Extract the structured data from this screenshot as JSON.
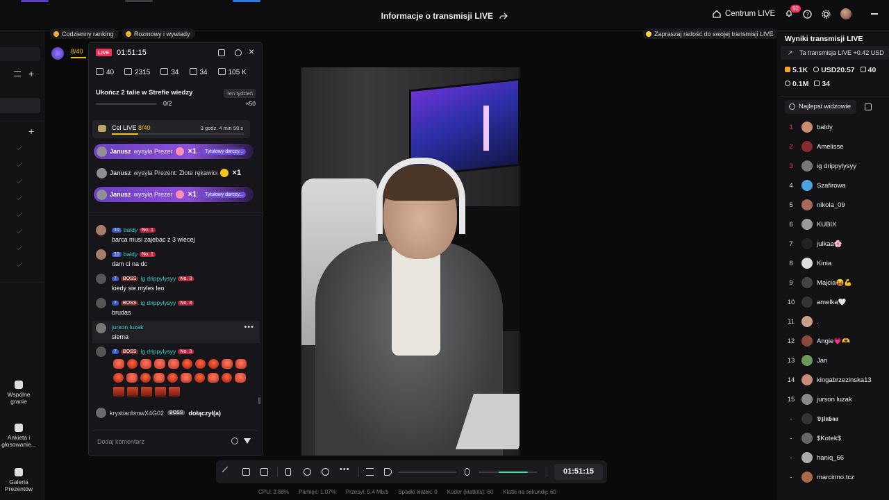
{
  "header": {
    "title": "Informacje o transmisji LIVE",
    "centrum_label": "Centrum LIVE",
    "notif_count": "92"
  },
  "pills": {
    "ranking": "Codzienny ranking",
    "rozmowy": "Rozmowy i wywiady",
    "invite": "Zapraszaj radość do swojej transmisji LIVE"
  },
  "level_indicator": "8/40",
  "chat": {
    "live_badge": "LIVE",
    "timer": "01:51:15",
    "stats": [
      "40",
      "2315",
      "34",
      "34",
      "105 K"
    ],
    "quest": {
      "title": "Ukończ 2 talie w Strefie wiedzy",
      "badge": "Ten tydzień",
      "progress": "0/2",
      "reward": "×50"
    },
    "goal": {
      "label": "Cel LIVE",
      "value": "8/40",
      "progress_fraction": 0.2,
      "time": "3 godz. 4 min 58 s"
    },
    "gifts": [
      {
        "name": "Janusz",
        "text": "wysyła Prezer",
        "count": "×1",
        "tag": "Tytułowy darczy...",
        "highlight": true
      },
      {
        "name": "Janusz",
        "text": "wysyła Prezent: Złote rękawice",
        "count": "×1",
        "tag": "",
        "highlight": false
      },
      {
        "name": "Janusz",
        "text": "wysyła Prezer",
        "count": "×1",
        "tag": "Tytułowy darczy...",
        "highlight": true
      }
    ],
    "messages": [
      {
        "level": "10",
        "boss": "",
        "name": "baldy",
        "no": "No. 1",
        "text": "barca musi zajebac z 3 wiecej"
      },
      {
        "level": "10",
        "boss": "",
        "name": "baldy",
        "no": "No. 1",
        "text": "dam ci na dc"
      },
      {
        "level": "7",
        "boss": "BOSS",
        "name": "ig drippylysyy",
        "no": "No. 3",
        "text": "kiedy sie myles leo"
      },
      {
        "level": "7",
        "boss": "BOSS",
        "name": "ig drippylysyy",
        "no": "No. 3",
        "text": "brudas"
      },
      {
        "level": "",
        "boss": "",
        "name": "jurson luzak",
        "no": "",
        "text": "siema"
      },
      {
        "level": "7",
        "boss": "BOSS",
        "name": "ig drippylysyy",
        "no": "No. 3",
        "text": ""
      }
    ],
    "joined": {
      "name": "krystianbmwX4G02",
      "boss": "BOSS",
      "text": "dołączył(a)"
    },
    "comment_placeholder": "Dodaj komentarz"
  },
  "toolbar": {
    "clock": "01:51:15",
    "volume_fraction": 0.0,
    "mic_fraction": 0.5
  },
  "footer": [
    "CPU: 2.88%",
    "Pamięć: 1.07%",
    "Przesył: 5.4 Mb/s",
    "Spadki klatek: 0",
    "Koder (klatki/s): 60",
    "Klatki na sekundę: 60"
  ],
  "sidebar_tools": [
    "Wspólne granie",
    "Ankieta i głosowanie...",
    "Galeria Prezentów"
  ],
  "right": {
    "title": "Wyniki transmisji LIVE",
    "boost": "Ta transmisja LIVE +0.42 USD",
    "stats1": [
      "5.1K",
      "USD20.57",
      "40"
    ],
    "stats2": [
      "0.1M",
      "34"
    ],
    "top_viewers_label": "Najlepsi widzowie",
    "viewers": [
      {
        "rank": "1",
        "name": "baldy"
      },
      {
        "rank": "2",
        "name": "Amelisse"
      },
      {
        "rank": "3",
        "name": "ig drippylysyy"
      },
      {
        "rank": "4",
        "name": "Szafirowa"
      },
      {
        "rank": "5",
        "name": "nikola_09"
      },
      {
        "rank": "6",
        "name": "KUBIX"
      },
      {
        "rank": "7",
        "name": "julkaa🌸"
      },
      {
        "rank": "8",
        "name": "Kinia"
      },
      {
        "rank": "9",
        "name": "Majcia😝💪"
      },
      {
        "rank": "10",
        "name": "amelka🤍"
      },
      {
        "rank": "11",
        "name": "."
      },
      {
        "rank": "12",
        "name": "Angie💗🫶"
      },
      {
        "rank": "13",
        "name": "Jan"
      },
      {
        "rank": "14",
        "name": "kingabrzezinska13"
      },
      {
        "rank": "15",
        "name": "jurson luzak"
      },
      {
        "rank": "-",
        "name": "𝕯𝖟𝖎𝖚𝖇𝖆𝖆"
      },
      {
        "rank": "-",
        "name": "$Kotek$"
      },
      {
        "rank": "-",
        "name": "haniq_66"
      },
      {
        "rank": "-",
        "name": "marcinno.tcz"
      }
    ]
  }
}
